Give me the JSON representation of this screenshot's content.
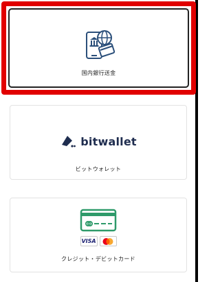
{
  "payment_methods": [
    {
      "id": "bank",
      "label": "国内銀行送金",
      "icon": "bank-transfer-icon",
      "selected": true
    },
    {
      "id": "bitwallet",
      "label": "ビットウォレット",
      "logo_text": "bitwallet",
      "icon": "bitwallet-logo-icon",
      "selected": false
    },
    {
      "id": "card",
      "label": "クレジット・デビットカード",
      "brands": [
        "VISA",
        "mastercard"
      ],
      "icon": "credit-card-icon",
      "selected": false
    }
  ],
  "colors": {
    "selection_highlight": "#e10000",
    "bank_icon": "#2b4f7a",
    "card_icon": "#2e9a6a",
    "bitwallet_brand": "#1f2d4f"
  }
}
